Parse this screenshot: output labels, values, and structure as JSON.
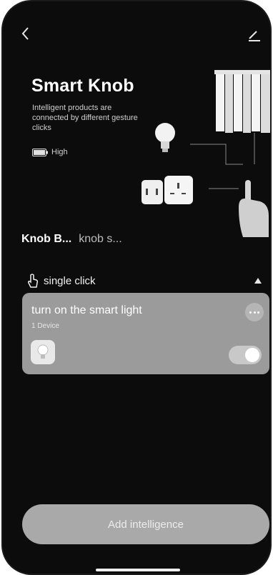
{
  "header": {
    "title": "Smart Knob",
    "subtitle": "Intelligent products are connected by different gesture clicks",
    "battery_label": "High"
  },
  "tabs": [
    {
      "label": "Knob B..."
    },
    {
      "label": "knob s..."
    }
  ],
  "section": {
    "title": "single click"
  },
  "scene_card": {
    "title": "turn on the smart light",
    "device_count": "1 Device",
    "enabled": true
  },
  "footer": {
    "add_button_label": "Add intelligence"
  },
  "icons": {
    "back": "chevron-left-icon",
    "edit": "pencil-icon",
    "battery": "battery-icon",
    "single_click": "hand-tap-icon",
    "collapse": "triangle-up-icon",
    "more": "more-dots-icon"
  }
}
